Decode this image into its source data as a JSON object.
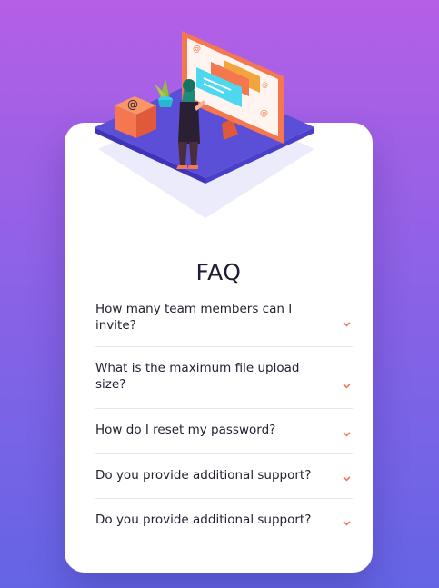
{
  "page": {
    "title": "FAQ"
  },
  "faq": {
    "items": [
      {
        "question": "How many team members can I invite?"
      },
      {
        "question": "What is the maximum file upload size?"
      },
      {
        "question": "How do I reset my password?"
      },
      {
        "question": "Do you provide additional support?"
      },
      {
        "question": "Do you provide additional support?"
      }
    ]
  },
  "colors": {
    "background_top": "#b45fe6",
    "background_bottom": "#6465e5",
    "card": "#ffffff",
    "arrow": "#f47c57",
    "text": "#1f2033",
    "divider": "#e8e8ea"
  },
  "icons": {
    "expand": "chevron-down-icon",
    "illustration": "woman-at-monitor-illustration"
  }
}
